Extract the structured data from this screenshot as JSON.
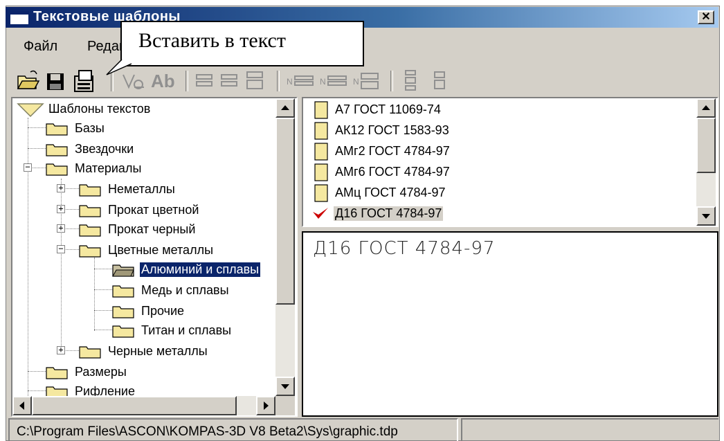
{
  "window": {
    "title": "Текстовые шаблоны",
    "close_symbol": "✕"
  },
  "menu": {
    "items": [
      {
        "label": "Файл"
      },
      {
        "label": "Редактор"
      }
    ]
  },
  "tooltip": {
    "text": "Вставить в текст"
  },
  "toolbar": {
    "buttons": [
      {
        "icon": "open-folder-icon"
      },
      {
        "icon": "save-icon"
      },
      {
        "icon": "insert-into-text-icon"
      },
      {
        "icon": "spellcheck-icon"
      },
      {
        "icon": "font-icon"
      },
      {
        "icon": "align-left-icon"
      },
      {
        "icon": "align-center-icon"
      },
      {
        "icon": "align-right-icon"
      },
      {
        "icon": "numbering-1-icon"
      },
      {
        "icon": "numbering-2-icon"
      },
      {
        "icon": "numbering-3-icon"
      },
      {
        "icon": "move-up-icon"
      },
      {
        "icon": "move-down-icon"
      }
    ],
    "font_button_label": "Ab"
  },
  "tree": {
    "root": "Шаблоны текстов",
    "items": [
      {
        "label": "Базы"
      },
      {
        "label": "Звездочки"
      },
      {
        "label": "Материалы",
        "expanded": true
      },
      {
        "label": "Неметаллы"
      },
      {
        "label": "Прокат цветной"
      },
      {
        "label": "Прокат черный"
      },
      {
        "label": "Цветные металлы",
        "expanded": true
      },
      {
        "label": "Алюминий и сплавы",
        "selected": true
      },
      {
        "label": "Медь и сплавы"
      },
      {
        "label": "Прочие"
      },
      {
        "label": "Титан и сплавы"
      },
      {
        "label": "Черные металлы"
      },
      {
        "label": "Размеры"
      },
      {
        "label": "Рифление"
      }
    ]
  },
  "files": {
    "items": [
      {
        "label": "А7 ГОСТ 11069-74"
      },
      {
        "label": "АК12 ГОСТ 1583-93"
      },
      {
        "label": "АМг2 ГОСТ 4784-97"
      },
      {
        "label": "АМг6 ГОСТ 4784-97"
      },
      {
        "label": "АМц ГОСТ 4784-97"
      },
      {
        "label": "Д16 ГОСТ 4784-97",
        "selected": true
      }
    ]
  },
  "preview": {
    "text": "Д16 ГОСТ 4784-97"
  },
  "status": {
    "path": "C:\\Program Files\\ASCON\\KOMPAS-3D V8 Beta2\\Sys\\graphic.tdp"
  },
  "colors": {
    "titlebar_start": "#0a246a",
    "titlebar_end": "#a6caf0",
    "selection": "#0a246a",
    "folder": "#f5e8a0",
    "checkmark": "#cc0000"
  }
}
